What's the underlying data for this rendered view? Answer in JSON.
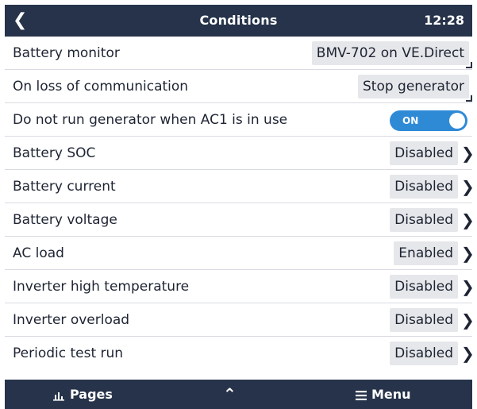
{
  "header": {
    "back_icon": "chevron-left-icon",
    "title": "Conditions",
    "time": "12:28"
  },
  "rows": [
    {
      "label": "Battery monitor",
      "value": "BMV-702 on VE.Direct",
      "kind": "enum"
    },
    {
      "label": "On loss of communication",
      "value": "Stop generator",
      "kind": "enum"
    },
    {
      "label": "Do not run generator when AC1 is in use",
      "value": "ON",
      "kind": "toggle"
    },
    {
      "label": "Battery SOC",
      "value": "Disabled",
      "kind": "submenu"
    },
    {
      "label": "Battery current",
      "value": "Disabled",
      "kind": "submenu"
    },
    {
      "label": "Battery voltage",
      "value": "Disabled",
      "kind": "submenu"
    },
    {
      "label": "AC load",
      "value": "Enabled",
      "kind": "submenu"
    },
    {
      "label": "Inverter high temperature",
      "value": "Disabled",
      "kind": "submenu"
    },
    {
      "label": "Inverter overload",
      "value": "Disabled",
      "kind": "submenu"
    },
    {
      "label": "Periodic test run",
      "value": "Disabled",
      "kind": "submenu"
    }
  ],
  "footer": {
    "pages_label": "Pages",
    "up_icon": "chevron-up-icon",
    "menu_label": "Menu"
  },
  "colors": {
    "header_bg": "#26334a",
    "toggle_on": "#2f8ad6",
    "value_bg": "#e6e7ea"
  }
}
